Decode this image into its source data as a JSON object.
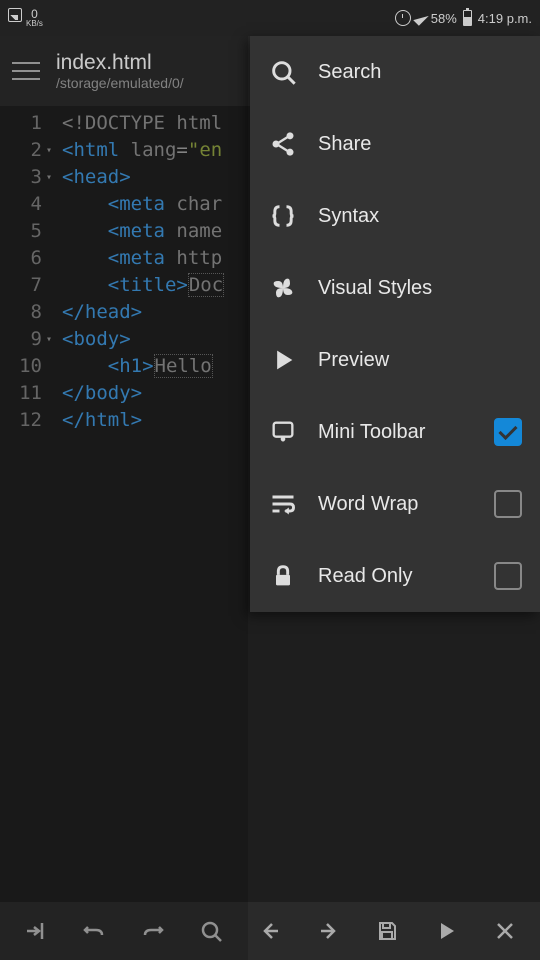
{
  "status": {
    "speed_value": "0",
    "speed_unit": "KB/s",
    "battery_pct": "58%",
    "time": "4:19 p.m."
  },
  "appbar": {
    "file_name": "index.html",
    "file_path": "/storage/emulated/0/"
  },
  "code": {
    "lines": [
      {
        "n": "1",
        "fold": false,
        "tokens": [
          {
            "c": "t-decl",
            "t": "<!DOCTYPE html"
          }
        ]
      },
      {
        "n": "2",
        "fold": true,
        "tokens": [
          {
            "c": "t-tag",
            "t": "<html"
          },
          {
            "c": "",
            "t": " "
          },
          {
            "c": "t-attr",
            "t": "lang"
          },
          {
            "c": "",
            "t": "="
          },
          {
            "c": "t-str",
            "t": "\"en"
          }
        ]
      },
      {
        "n": "3",
        "fold": true,
        "tokens": [
          {
            "c": "t-tag",
            "t": "<head>"
          }
        ]
      },
      {
        "n": "4",
        "fold": false,
        "tokens": [
          {
            "c": "",
            "t": "    "
          },
          {
            "c": "t-tag",
            "t": "<meta"
          },
          {
            "c": "",
            "t": " "
          },
          {
            "c": "t-attr",
            "t": "char"
          }
        ]
      },
      {
        "n": "5",
        "fold": false,
        "tokens": [
          {
            "c": "",
            "t": "    "
          },
          {
            "c": "t-tag",
            "t": "<meta"
          },
          {
            "c": "",
            "t": " "
          },
          {
            "c": "t-attr",
            "t": "name"
          }
        ]
      },
      {
        "n": "6",
        "fold": false,
        "tokens": [
          {
            "c": "",
            "t": "    "
          },
          {
            "c": "t-tag",
            "t": "<meta"
          },
          {
            "c": "",
            "t": " "
          },
          {
            "c": "t-attr",
            "t": "http"
          }
        ]
      },
      {
        "n": "7",
        "fold": false,
        "tokens": [
          {
            "c": "",
            "t": "    "
          },
          {
            "c": "t-tag",
            "t": "<title>"
          },
          {
            "c": "t-text",
            "t": "Doc"
          }
        ]
      },
      {
        "n": "8",
        "fold": false,
        "tokens": [
          {
            "c": "t-tag",
            "t": "</head>"
          }
        ]
      },
      {
        "n": "9",
        "fold": true,
        "tokens": [
          {
            "c": "t-tag",
            "t": "<body>"
          }
        ]
      },
      {
        "n": "10",
        "fold": false,
        "tokens": [
          {
            "c": "",
            "t": "    "
          },
          {
            "c": "t-tag",
            "t": "<h1>"
          },
          {
            "c": "t-text",
            "t": "Hello"
          }
        ]
      },
      {
        "n": "11",
        "fold": false,
        "tokens": [
          {
            "c": "t-tag",
            "t": "</body>"
          }
        ]
      },
      {
        "n": "12",
        "fold": false,
        "tokens": [
          {
            "c": "t-tag",
            "t": "</html>"
          }
        ]
      }
    ]
  },
  "menu": {
    "items": [
      {
        "icon": "search",
        "label": "Search",
        "check": null
      },
      {
        "icon": "share",
        "label": "Share",
        "check": null
      },
      {
        "icon": "braces",
        "label": "Syntax",
        "check": null
      },
      {
        "icon": "fan",
        "label": "Visual Styles",
        "check": null
      },
      {
        "icon": "play",
        "label": "Preview",
        "check": null
      },
      {
        "icon": "cast",
        "label": "Mini Toolbar",
        "check": true
      },
      {
        "icon": "wrap",
        "label": "Word Wrap",
        "check": false
      },
      {
        "icon": "lock",
        "label": "Read Only",
        "check": false
      }
    ]
  },
  "toolbar": {
    "items": [
      "indent",
      "undo",
      "redo",
      "search",
      "back",
      "forward",
      "save",
      "run",
      "close"
    ]
  }
}
